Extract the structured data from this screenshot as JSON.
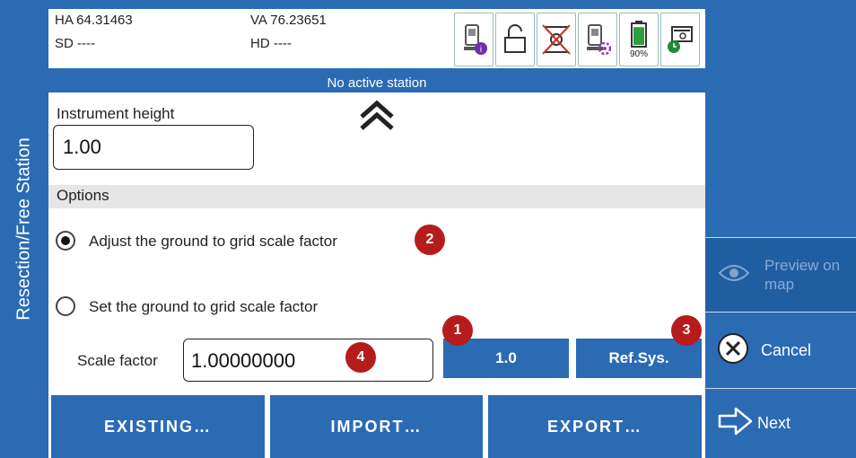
{
  "sidebar": {
    "title": "Resection/Free Station"
  },
  "readout": {
    "ha": "HA 64.31463",
    "va": "VA 76.23651",
    "sd": "SD ----",
    "hd": "HD ----"
  },
  "status": {
    "icons": [
      "instrument-info-icon",
      "unlock-icon",
      "no-prism-icon",
      "instrument-settings-icon",
      "battery-icon",
      "connection-icon"
    ],
    "battery_label": "90%",
    "battery_level": 0.9,
    "instrument_badge": "i"
  },
  "station": {
    "text": "No active station"
  },
  "form": {
    "instrument_height_label": "Instrument height",
    "instrument_height_value": "1.00",
    "options_label": "Options",
    "radio_adjust": {
      "label": "Adjust the ground to grid scale factor",
      "selected": true
    },
    "radio_set": {
      "label": "Set the ground to grid scale factor",
      "selected": false
    },
    "scale_factor_label": "Scale factor",
    "scale_factor_value": "1.00000000",
    "btn_one": "1.0",
    "btn_refsys": "Ref.Sys."
  },
  "badges": {
    "b1": "1",
    "b2": "2",
    "b3": "3",
    "b4": "4"
  },
  "bottom": {
    "existing": "EXISTING…",
    "import": "IMPORT…",
    "export": "EXPORT…"
  },
  "right": {
    "preview_line1": "Preview on",
    "preview_line2": "map",
    "cancel": "Cancel",
    "next": "Next"
  },
  "colors": {
    "primary": "#2a6bb4",
    "badge": "#b71c1c",
    "options_bg": "#e6e6e6"
  }
}
